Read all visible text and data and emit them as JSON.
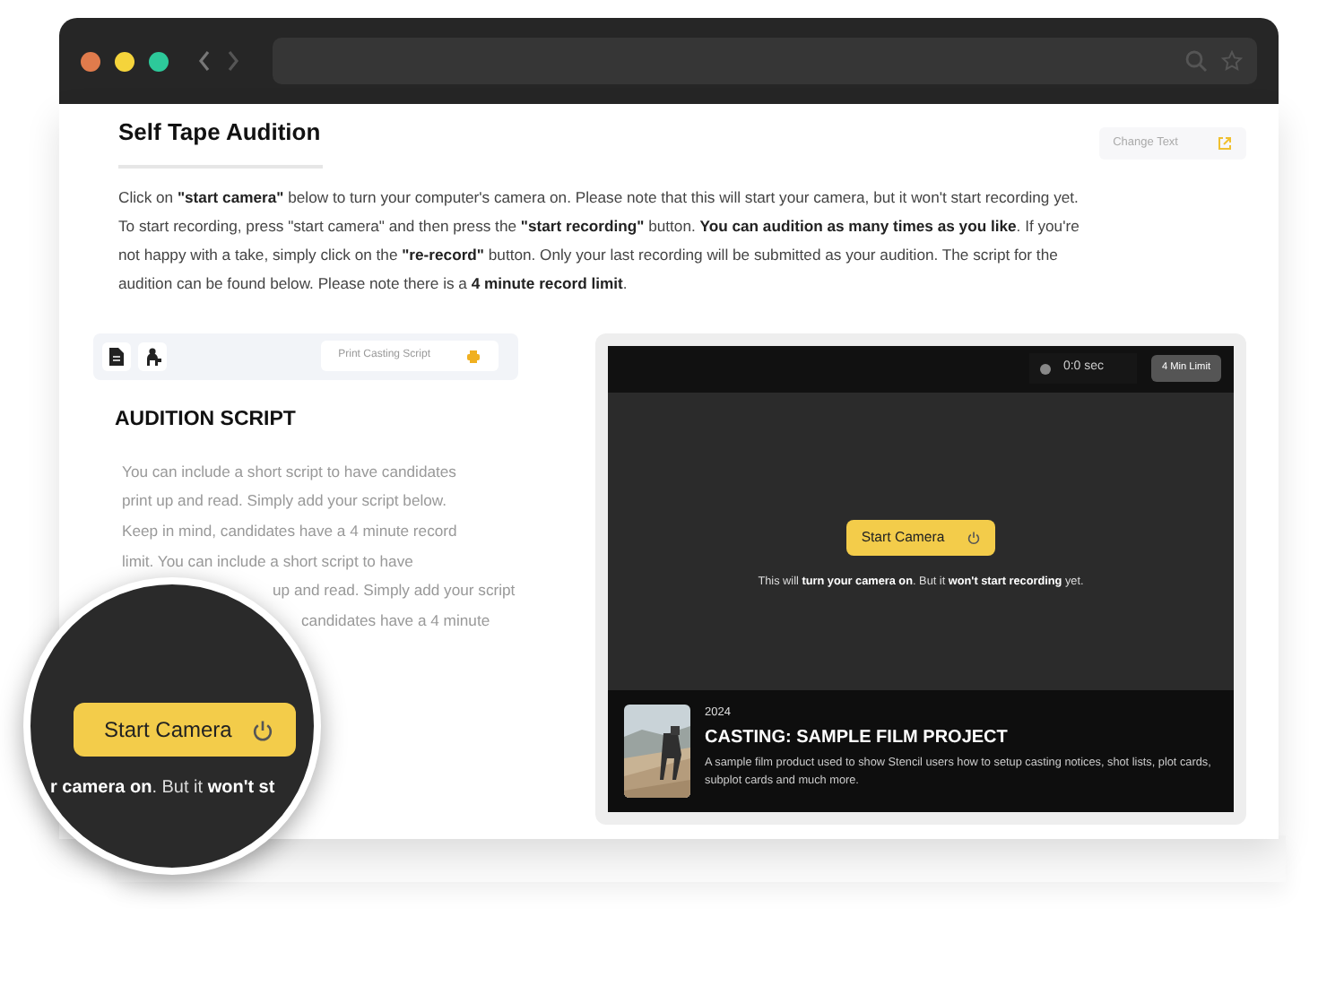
{
  "page": {
    "title": "Self Tape Audition",
    "change_text_button": "Change Text",
    "intro": "Click on **\"start camera\"** below to turn your computer's camera on. Please note that this will start your camera, but it won't start recording yet. To start recording, press \"start camera\" and then press the **\"start recording\"** button. **You can audition as many times as you like**. If you're not happy with a take, simply click on the **\"re-record\"** button. Only your last recording will be submitted as your audition. The script for the audition can be found below. Please note there is a **4 minute record limit**."
  },
  "script_panel": {
    "tools": [
      {
        "kind": "document"
      },
      {
        "kind": "person"
      }
    ],
    "print_button": "Print Casting Script",
    "heading": "AUDITION SCRIPT",
    "lines": [
      "You can include a short script to have candidates",
      "print up and read. Simply add your script below.",
      "Keep in mind, candidates have a 4 minute record",
      "limit. You can include a short script to have",
      "up and read. Simply add your script",
      "candidates have a 4 minute"
    ]
  },
  "recorder": {
    "timer": "0:0 sec",
    "limit": "4 Min Limit",
    "start_button": "Start Camera",
    "caption": "This will **turn your camera on**. But it **won't start recording** yet.",
    "project": {
      "year": "2024",
      "title": "CASTING: SAMPLE FILM PROJECT",
      "description": "A sample film product used to show Stencil users how to setup casting notices, shot lists, plot cards, subplot cards and much more."
    }
  },
  "magnifier": {
    "button": "Start Camera",
    "caption": "**r camera on**. But it **won't st**"
  }
}
